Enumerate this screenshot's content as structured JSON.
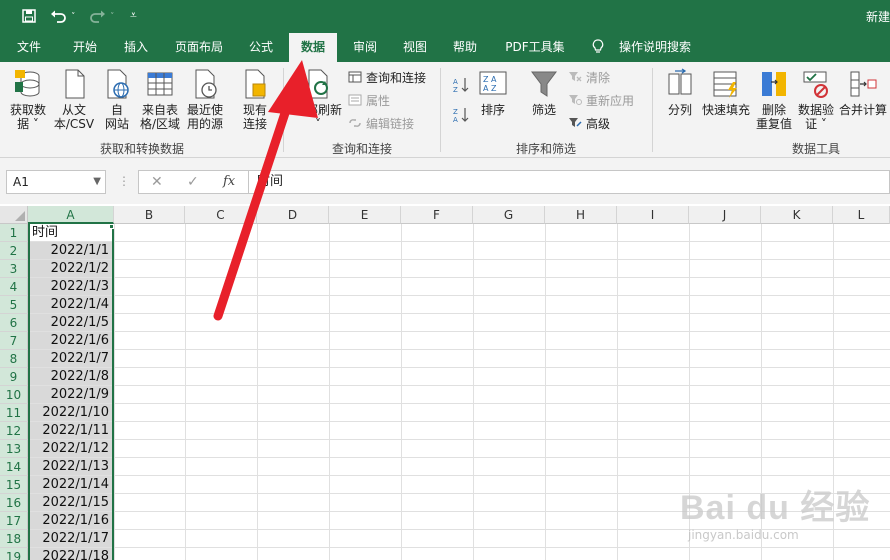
{
  "document": {
    "title_partial": "新建"
  },
  "tabs": [
    {
      "id": "file",
      "label": "文件"
    },
    {
      "id": "home",
      "label": "开始"
    },
    {
      "id": "insert",
      "label": "插入"
    },
    {
      "id": "layout",
      "label": "页面布局"
    },
    {
      "id": "formulas",
      "label": "公式"
    },
    {
      "id": "data",
      "label": "数据",
      "active": true
    },
    {
      "id": "review",
      "label": "审阅"
    },
    {
      "id": "view",
      "label": "视图"
    },
    {
      "id": "help",
      "label": "帮助"
    },
    {
      "id": "pdf",
      "label": "PDF工具集"
    },
    {
      "id": "tellme",
      "label": "操作说明搜索"
    }
  ],
  "ribbon": {
    "get_transform": {
      "label": "获取和转换数据",
      "buttons": [
        {
          "id": "get_data",
          "l1": "获取数",
          "l2": "据 ˅"
        },
        {
          "id": "from_csv",
          "l1": "从文",
          "l2": "本/CSV"
        },
        {
          "id": "from_web",
          "l1": "自",
          "l2": "网站"
        },
        {
          "id": "from_table",
          "l1": "来自表",
          "l2": "格/区域"
        },
        {
          "id": "recent",
          "l1": "最近使",
          "l2": "用的源"
        },
        {
          "id": "existing",
          "l1": "现有",
          "l2": "连接"
        }
      ]
    },
    "queries": {
      "label": "查询和连接",
      "refresh_all": "全部刷新",
      "refresh_dropdown": "˅",
      "queries_connections": "查询和连接",
      "properties": "属性",
      "edit_links": "编辑链接"
    },
    "sort_filter": {
      "label": "排序和筛选",
      "sort": "排序",
      "filter": "筛选",
      "clear": "清除",
      "reapply": "重新应用",
      "advanced": "高级"
    },
    "data_tools": {
      "label": "数据工具",
      "split": "分列",
      "flash_fill": "快速填充",
      "remove_dup_1": "删除",
      "remove_dup_2": "重复值",
      "validation_1": "数据验",
      "validation_2": "证 ˅",
      "consolidate": "合并计算"
    }
  },
  "formula_bar": {
    "name_box": "A1",
    "cancel_symbol": "✕",
    "enter_symbol": "✓",
    "fx_symbol": "fx",
    "content": "时间"
  },
  "sheet": {
    "columns": [
      "A",
      "B",
      "C",
      "D",
      "E",
      "F",
      "G",
      "H",
      "I",
      "J",
      "K",
      "L"
    ],
    "rows": [
      "1",
      "2",
      "3",
      "4",
      "5",
      "6",
      "7",
      "8",
      "9",
      "10",
      "11",
      "12",
      "13",
      "14",
      "15",
      "16",
      "17",
      "18",
      "19"
    ],
    "colA_values": [
      "时间",
      "2022/1/1",
      "2022/1/2",
      "2022/1/3",
      "2022/1/4",
      "2022/1/5",
      "2022/1/6",
      "2022/1/7",
      "2022/1/8",
      "2022/1/9",
      "2022/1/10",
      "2022/1/11",
      "2022/1/12",
      "2022/1/13",
      "2022/1/14",
      "2022/1/15",
      "2022/1/16",
      "2022/1/17",
      "2022/1/18"
    ]
  },
  "watermark": {
    "logo": "Bai du 经验",
    "url": "jingyan.baidu.com"
  },
  "colors": {
    "accent": "#217346",
    "annotation_arrow": "#e8202a"
  }
}
